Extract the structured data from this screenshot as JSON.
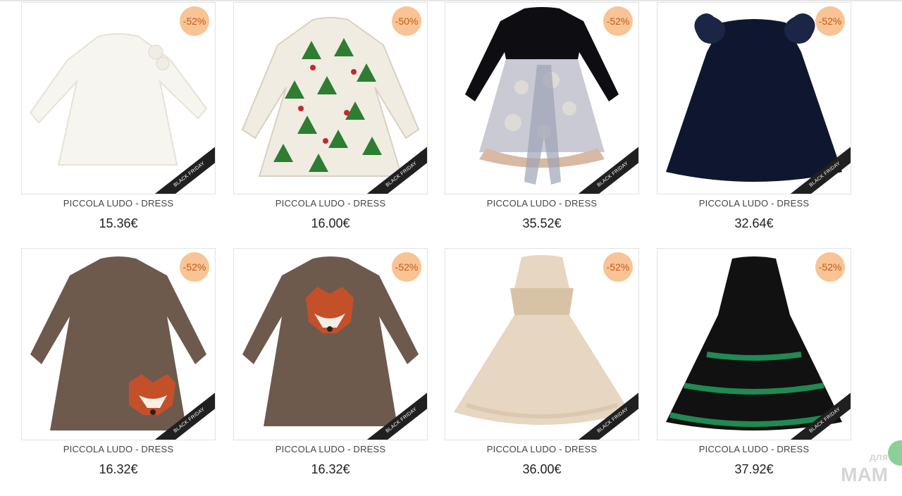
{
  "products": [
    {
      "discount": "-52%",
      "ribbon": "BLACK FRIDAY",
      "title": "PICCOLA LUDO - DRESS",
      "price": "15.36€",
      "icon": "white-dress-icon",
      "colors": {
        "main": "#f7f5ef",
        "accent": "#e6e2d8"
      }
    },
    {
      "discount": "-50%",
      "ribbon": "BLACK FRIDAY",
      "title": "PICCOLA LUDO - DRESS",
      "price": "16.00€",
      "icon": "tree-print-dress-icon",
      "colors": {
        "main": "#f0ece2",
        "accent": "#2e7d32"
      }
    },
    {
      "discount": "-52%",
      "ribbon": "BLACK FRIDAY",
      "title": "PICCOLA LUDO - DRESS",
      "price": "35.52€",
      "icon": "floral-skirt-dress-icon",
      "colors": {
        "main": "#0e0e12",
        "accent": "#c9cad4"
      }
    },
    {
      "discount": "-52%",
      "ribbon": "BLACK FRIDAY",
      "title": "PICCOLA LUDO - DRESS",
      "price": "32.64€",
      "icon": "navy-velvet-dress-icon",
      "colors": {
        "main": "#0f1730",
        "accent": "#1b2545"
      }
    },
    {
      "discount": "-52%",
      "ribbon": "BLACK FRIDAY",
      "title": "PICCOLA LUDO - DRESS",
      "price": "16.32€",
      "icon": "brown-fox-pocket-dress-icon",
      "colors": {
        "main": "#6d5a4c",
        "accent": "#c4502a"
      }
    },
    {
      "discount": "-52%",
      "ribbon": "BLACK FRIDAY",
      "title": "PICCOLA LUDO - DRESS",
      "price": "16.32€",
      "icon": "brown-fox-face-dress-icon",
      "colors": {
        "main": "#6d5a4c",
        "accent": "#c4502a"
      }
    },
    {
      "discount": "-52%",
      "ribbon": "BLACK FRIDAY",
      "title": "PICCOLA LUDO - DRESS",
      "price": "36.00€",
      "icon": "beige-tulle-dress-icon",
      "colors": {
        "main": "#e6d6c2",
        "accent": "#d7c2a6"
      }
    },
    {
      "discount": "-52%",
      "ribbon": "BLACK FRIDAY",
      "title": "PICCOLA LUDO - DRESS",
      "price": "37.92€",
      "icon": "black-green-tiered-dress-icon",
      "colors": {
        "main": "#111111",
        "accent": "#1f8a52"
      }
    }
  ],
  "watermark": {
    "line1": "для",
    "line2": "МАМ"
  }
}
